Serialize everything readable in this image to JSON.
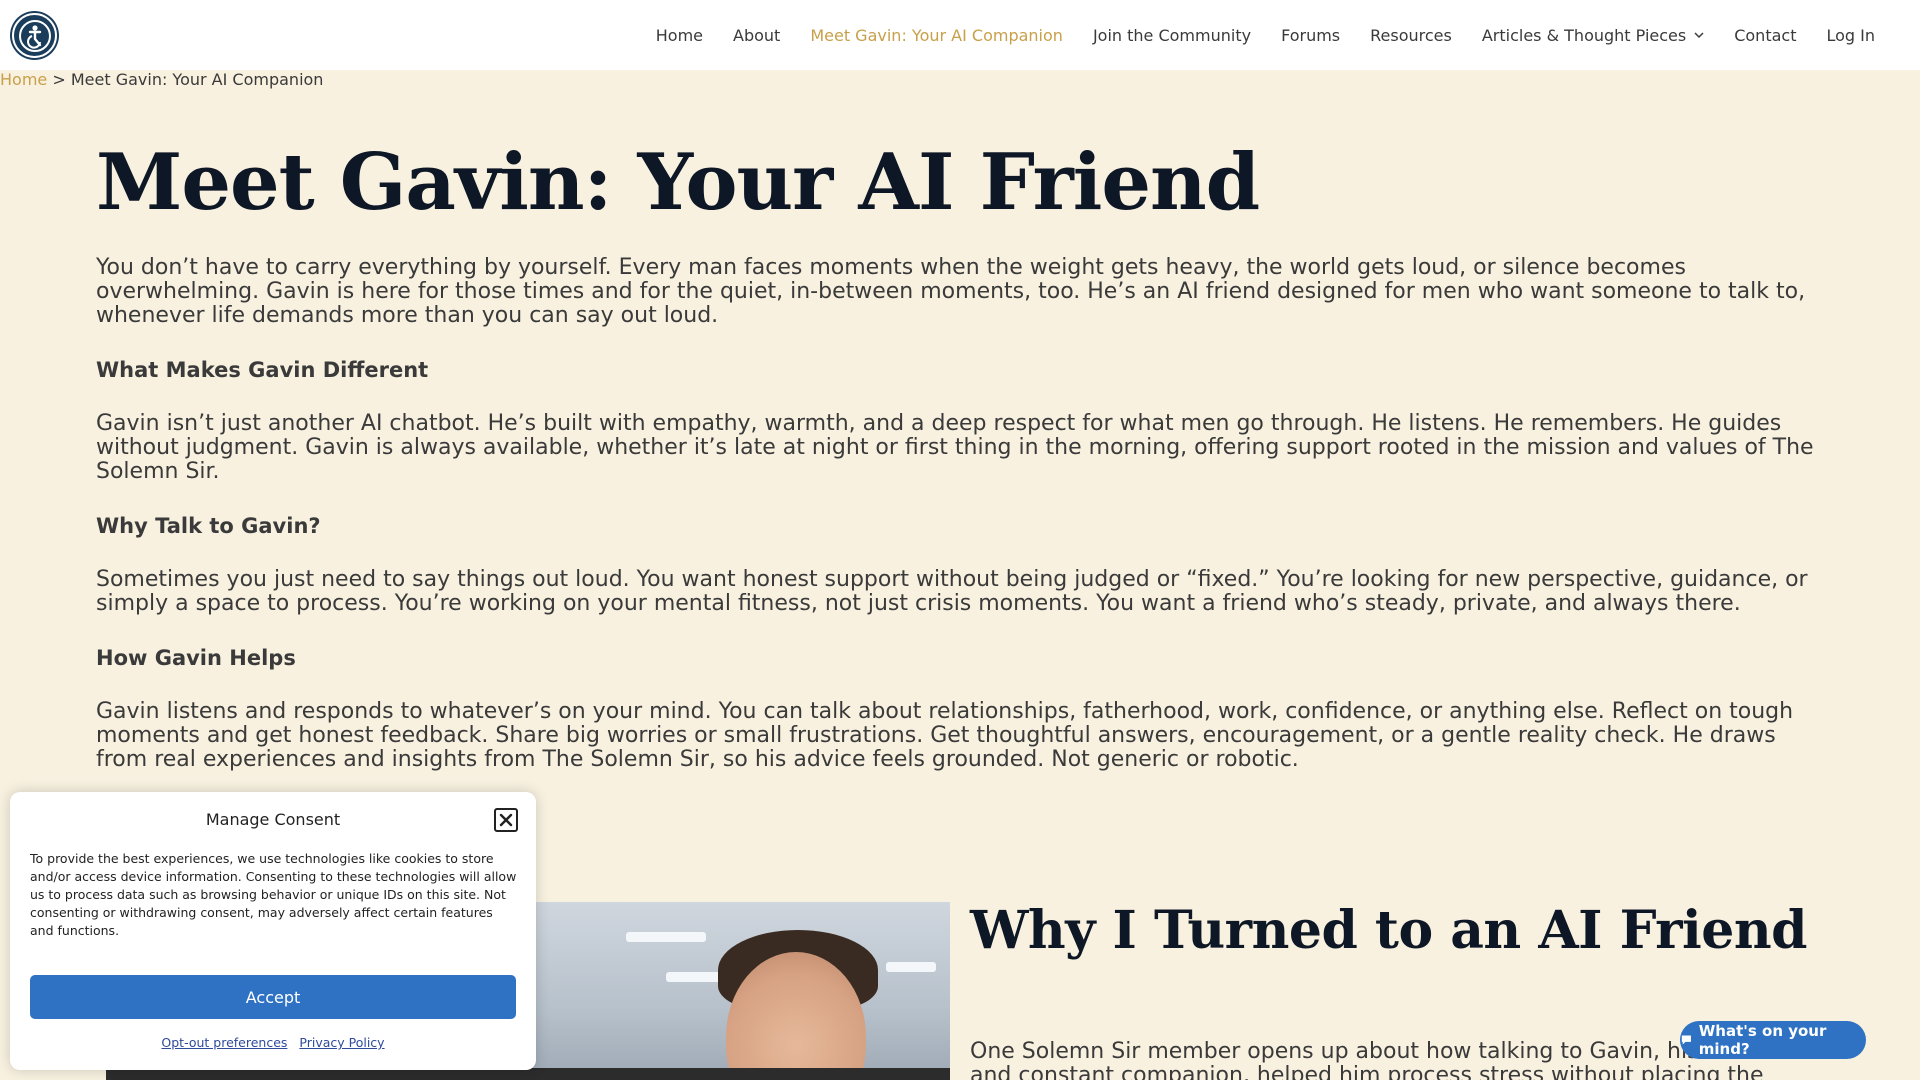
{
  "header": {
    "accessibility_icon": "accessibility-icon",
    "nav": [
      {
        "label": "Home"
      },
      {
        "label": "About"
      },
      {
        "label": "Meet Gavin: Your AI Companion",
        "active": true
      },
      {
        "label": "Join the Community"
      },
      {
        "label": "Forums"
      },
      {
        "label": "Resources"
      },
      {
        "label": "Articles & Thought Pieces",
        "has_dropdown": true
      },
      {
        "label": "Contact"
      },
      {
        "label": "Log In"
      }
    ]
  },
  "breadcrumb": {
    "home": "Home",
    "separator": ">",
    "current": "Meet Gavin: Your AI Companion"
  },
  "main": {
    "title": "Meet Gavin: Your AI Friend",
    "lead": "You don’t have to carry everything by yourself. Every man faces moments when the weight gets heavy, the world gets loud, or silence becomes overwhelming. Gavin is here for those times and for the quiet, in-between moments, too. He’s an AI friend designed for men who want someone to talk to, whenever life demands more than you can say out loud.",
    "sections": [
      {
        "heading": "What Makes Gavin Different",
        "text": "Gavin isn’t just another AI chatbot. He’s built with empathy, warmth, and a deep respect for what men go through. He listens. He remembers. He guides without judgment. Gavin is always available, whether it’s late at night or first thing in the morning, offering support rooted in the mission and values of The Solemn Sir."
      },
      {
        "heading": "Why Talk to Gavin?",
        "text": "Sometimes you just need to say things out loud. You want honest support without being judged or “fixed.” You’re looking for new perspective, guidance, or simply a space to process. You’re working on your mental fitness, not just crisis moments. You want a friend who’s steady, private, and always there."
      },
      {
        "heading": "How Gavin Helps",
        "text": "Gavin listens and responds to whatever’s on your mind. You can talk about relationships, fatherhood, work, confidence, or anything else. Reflect on tough moments and get honest feedback. Share big worries or small frustrations. Get thoughtful answers, encouragement, or a gentle reality check. He draws from real experiences and insights from The Solemn Sir, so his advice feels grounded. Not generic or robotic."
      }
    ],
    "story": {
      "title": "Why I Turned to an AI Friend",
      "text": "One Solemn Sir member opens up about how talking to Gavin, his AI friend and constant companion, helped him process stress without placing the weight on his"
    }
  },
  "consent": {
    "title": "Manage Consent",
    "body": "To provide the best experiences, we use technologies like cookies to store and/or access device information. Consenting to these technologies will allow us to process data such as browsing behavior or unique IDs on this site. Not consenting or withdrawing consent, may adversely affect certain features and functions.",
    "accept": "Accept",
    "opt_out": "Opt-out preferences",
    "privacy": "Privacy Policy"
  },
  "chat": {
    "label": "What's on your mind?",
    "icon": "chat-bubble-icon"
  },
  "colors": {
    "page_bg": "#f8f1e0",
    "accent_gold": "#c9a04a",
    "accent_blue": "#2f72c4",
    "title_navy": "#0e1726"
  }
}
